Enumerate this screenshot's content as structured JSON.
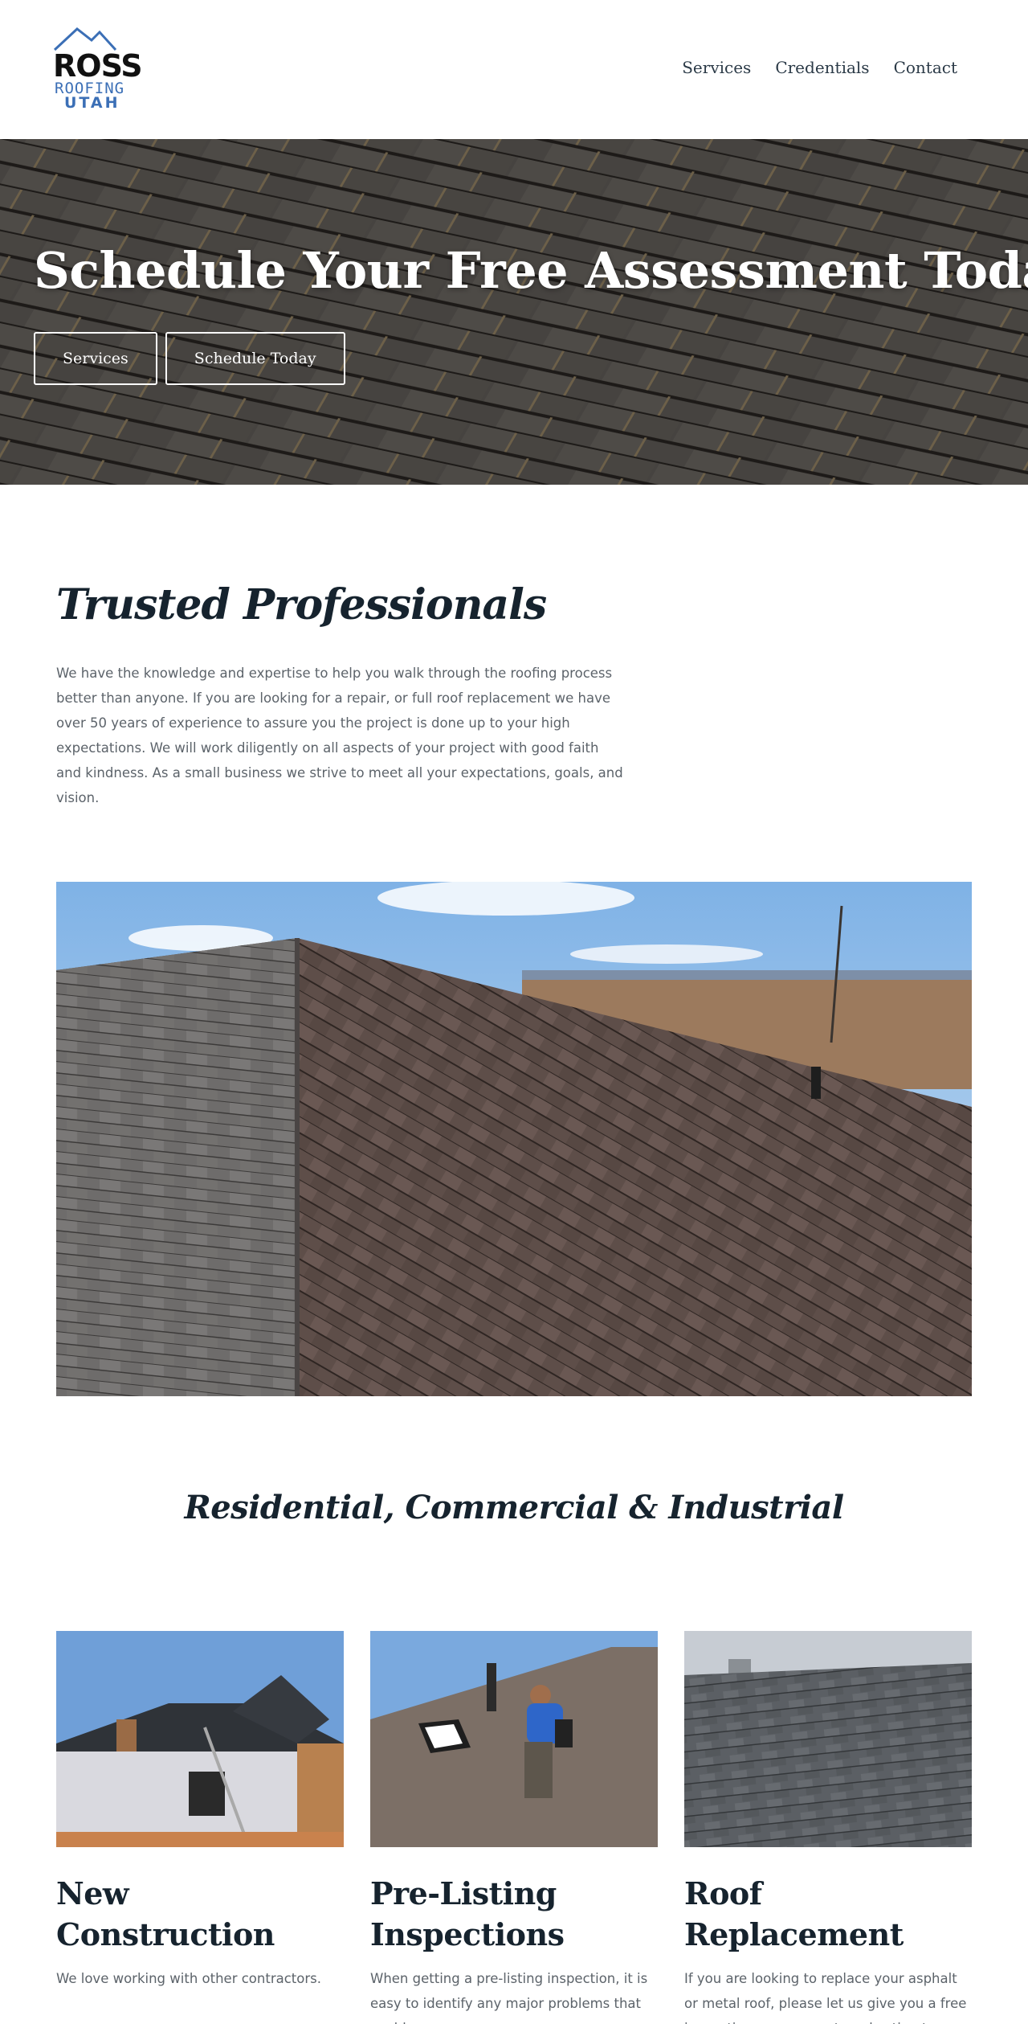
{
  "header": {
    "logo": {
      "line1": "ROSS",
      "line2": "ROOFING",
      "line3": "UTAH"
    },
    "nav": [
      {
        "label": "Services"
      },
      {
        "label": "Credentials"
      },
      {
        "label": "Contact"
      }
    ]
  },
  "hero": {
    "title": "Schedule Your Free Assessment Today",
    "buttons": [
      {
        "label": "Services"
      },
      {
        "label": "Schedule Today"
      }
    ]
  },
  "trusted": {
    "title": "Trusted Professionals",
    "text": "We have the knowledge and expertise to help you walk through the roofing process better than anyone. If you are looking for a repair, or full roof replacement we have over 50 years of experience to assure you the project is done up to your high expectations. We will work diligently on all aspects of your project with good faith and kindness. As a small business we strive to meet all your expectations, goals, and vision."
  },
  "sectors": {
    "title": "Residential, Commercial & Industrial"
  },
  "cards": [
    {
      "title": "New Construction",
      "text": "We love working with other contractors."
    },
    {
      "title": "Pre-Listing Inspections",
      "text": "When getting a pre-listing inspection, it is easy to identify any major problems that could"
    },
    {
      "title": "Roof Replacement",
      "text": "If you are looking to replace your asphalt or metal roof, please let us give you a free inspection, assessment, and estimate."
    }
  ],
  "colors": {
    "heading": "#16232e",
    "body_text": "#5c636a",
    "logo_blue": "#3b6fb6",
    "logo_black": "#111111"
  }
}
